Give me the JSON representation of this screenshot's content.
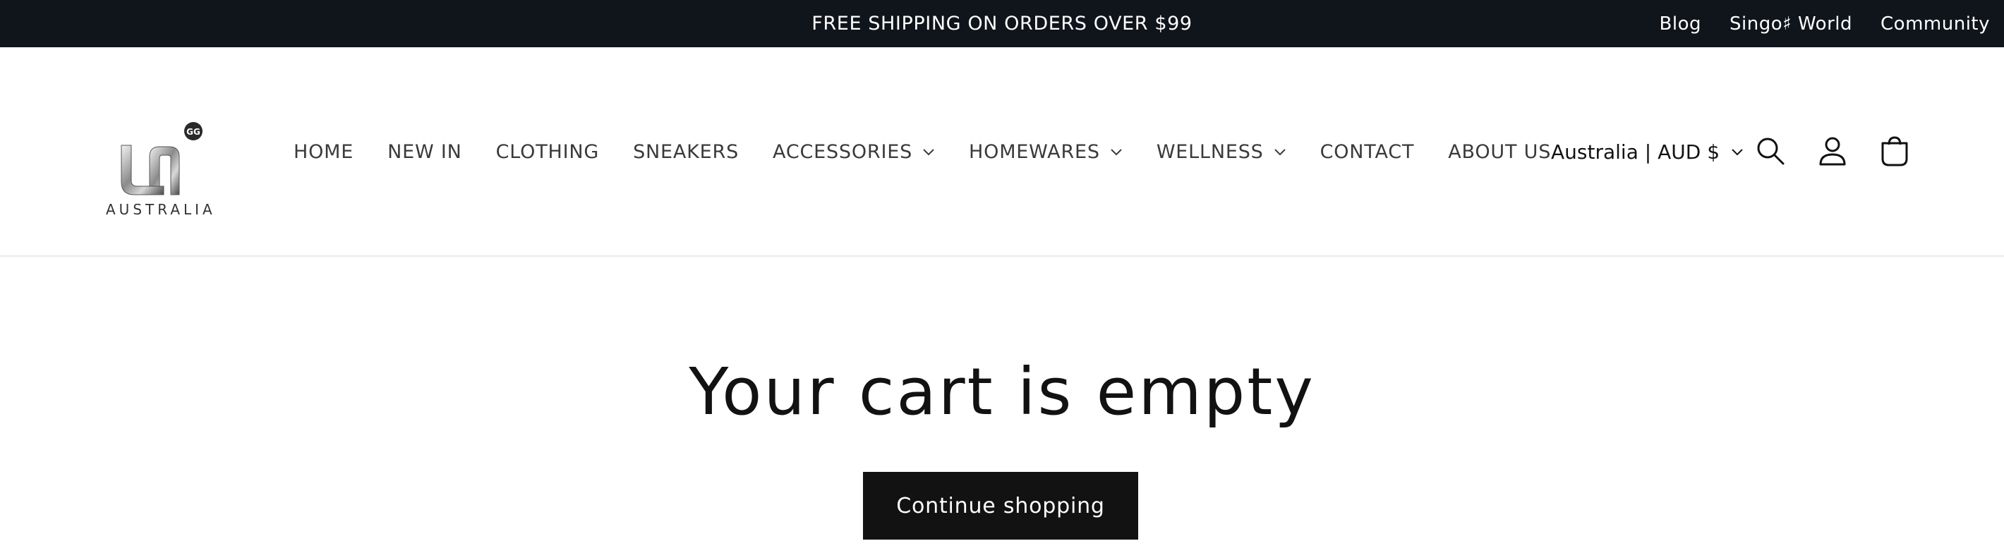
{
  "announcement": {
    "promo_text": "FREE SHIPPING ON ORDERS OVER $99",
    "links": [
      "Blog",
      "Singo♯ World",
      "Community"
    ]
  },
  "header": {
    "logo_text": "AUSTRALIA",
    "nav": [
      {
        "label": "HOME",
        "has_dropdown": false
      },
      {
        "label": "NEW IN",
        "has_dropdown": false
      },
      {
        "label": "CLOTHING",
        "has_dropdown": false
      },
      {
        "label": "SNEAKERS",
        "has_dropdown": false
      },
      {
        "label": "ACCESSORIES",
        "has_dropdown": true
      },
      {
        "label": "HOMEWARES",
        "has_dropdown": true
      },
      {
        "label": "WELLNESS",
        "has_dropdown": true
      },
      {
        "label": "CONTACT",
        "has_dropdown": false
      },
      {
        "label": "ABOUT US",
        "has_dropdown": false
      }
    ],
    "locale": "Australia | AUD $",
    "icons": {
      "search": "search-icon",
      "account": "user-icon",
      "cart": "cart-icon"
    }
  },
  "main": {
    "title": "Your cart is empty",
    "continue_label": "Continue shopping"
  },
  "colors": {
    "announcement_bg": "#10141b",
    "button_bg": "#121212",
    "text": "#121212"
  }
}
